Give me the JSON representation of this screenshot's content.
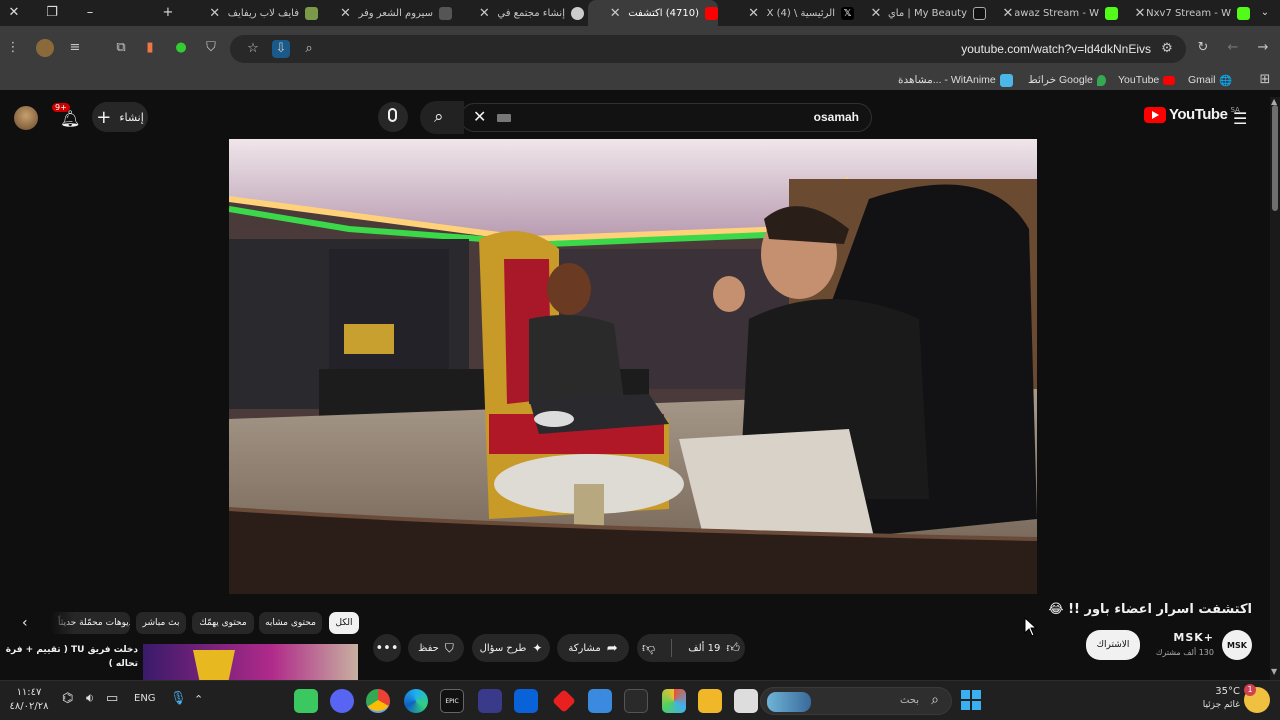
{
  "browser": {
    "tabs": [
      {
        "title": "Nxv7 Stream - W",
        "favicon_color": "#53fc18"
      },
      {
        "title": "Fawaz Stream - W",
        "favicon_color": "#53fc18"
      },
      {
        "title": "My Beauty | ماي",
        "favicon_color": "#111111"
      },
      {
        "title": "الرئيسية \\ X (4)",
        "favicon_color": "#000000"
      },
      {
        "title": "(4710) اكتشفت",
        "favicon_color": "#ff0000"
      },
      {
        "title": "إنشاء مجتمع في",
        "favicon_color": "#cccccc"
      },
      {
        "title": "سيروم الشعر وفر",
        "favicon_color": "#555555"
      },
      {
        "title": "فايف لاب ريفايف",
        "favicon_color": "#7a9a4a"
      }
    ],
    "url": "youtube.com/watch?v=ld4dkNnEivs",
    "bookmarks": [
      "Gmail",
      "YouTube",
      "خرائط Google",
      "مشاهدة... - WitAnime"
    ]
  },
  "youtube": {
    "logo_text": "YouTube",
    "region": "SA",
    "search_value": "osamah",
    "create_label": "إنشاء",
    "notifications_badge": "9+",
    "video_title": "اكتشفت اسرار اعضاء باور !! 😂",
    "channel_name": "MSK+",
    "subscribers": "130 ألف مشترك",
    "subscribe_label": "الاشتراك",
    "likes": "19 ألف",
    "share_label": "مشاركة",
    "ask_label": "طرح سؤال",
    "save_label": "حفظ",
    "chips": [
      "الكل",
      "محتوى مشابه",
      "محتوى يهمّك",
      "بث مباشر",
      "فيديوهات محمّلة حديثاً"
    ],
    "rec_title_1": "دخلت فريق TU ( تقييم + فرة",
    "rec_title_2": "تحاله )"
  },
  "taskbar": {
    "weather_temp": "35°C",
    "weather_label": "غائم جزئيا",
    "search_placeholder": "بحث",
    "lang": "ENG",
    "time": "١١:٤٧",
    "date": "٤٨/٠٢/٢٨",
    "notif_count": "1"
  }
}
